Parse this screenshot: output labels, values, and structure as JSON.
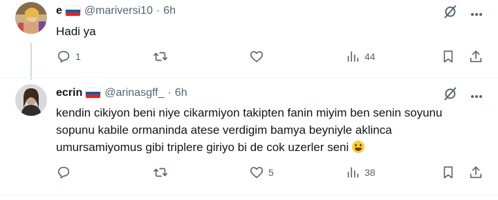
{
  "tweets": [
    {
      "name": "e",
      "handle": "@mariversi10",
      "separator": "·",
      "time": "6h",
      "text": "Hadi ya",
      "replies": "1",
      "retweets": "",
      "likes": "",
      "views": "44",
      "flag_icon": "russia-flag-icon"
    },
    {
      "name": "ecrin",
      "handle": "@arinasgff_",
      "separator": "·",
      "time": "6h",
      "text": "kendin cikiyon beni niye cikarmiyon takipten fanin miyim ben senin soyunu sopunu kabile ormaninda atese verdigim bamya beyniyle aklinca umursamiyomus gibi triplere giriyo bi de cok uzerler seni",
      "replies": "",
      "retweets": "",
      "likes": "5",
      "views": "38",
      "flag_icon": "russia-flag-icon",
      "emoji_icon": "face-with-tears-of-joy-icon"
    }
  ],
  "colors": {
    "text": "#0f1419",
    "secondary": "#536471",
    "divider": "#eff3f4",
    "thread": "#cfd9de"
  }
}
